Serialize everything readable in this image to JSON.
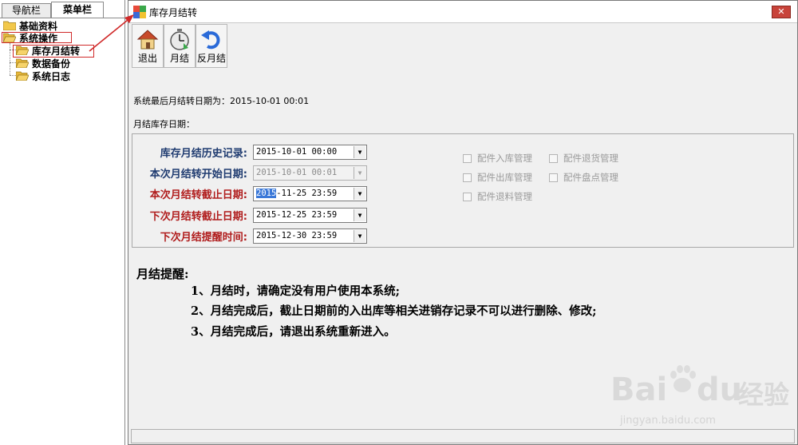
{
  "left_pane": {
    "tabs": [
      "导航栏",
      "菜单栏"
    ],
    "tree": [
      {
        "label": "基础资料",
        "level": 0
      },
      {
        "label": "系统操作",
        "level": 0
      },
      {
        "label": "库存月结转",
        "level": 1
      },
      {
        "label": "数据备份",
        "level": 1
      },
      {
        "label": "系统日志",
        "level": 1
      }
    ]
  },
  "window": {
    "title": "库存月结转",
    "close_label": "✕",
    "toolbar": [
      {
        "label": "退出",
        "icon": "home-icon"
      },
      {
        "label": "月结",
        "icon": "stopwatch-icon"
      },
      {
        "label": "反月结",
        "icon": "undo-icon"
      }
    ],
    "last_close_text": "系统最后月结转日期为：2015-10-01 00:01",
    "inventory_date_label": "月结库存日期：",
    "fields": [
      {
        "label": "库存月结历史记录:",
        "value": "2015-10-01 00:00",
        "color": "navy",
        "disabled": false
      },
      {
        "label": "本次月结转开始日期:",
        "value": "2015-10-01 00:01",
        "color": "navy",
        "disabled": true
      },
      {
        "label": "本次月结转截止日期:",
        "value_selected": "2015",
        "value_rest": "-11-25 23:59",
        "color": "red",
        "disabled": false
      },
      {
        "label": "下次月结转截止日期:",
        "value": "2015-12-25 23:59",
        "color": "red",
        "disabled": false
      },
      {
        "label": "下次月结提醒时间:",
        "value": "2015-12-30 23:59",
        "color": "red",
        "disabled": false
      }
    ],
    "checkboxes": [
      "配件入库管理",
      "配件退货管理",
      "配件出库管理",
      "配件盘点管理",
      "配件退料管理"
    ],
    "reminder": {
      "title": "月结提醒:",
      "items": [
        "1、月结时，请确定没有用户使用本系统;",
        "2、月结完成后，截止日期前的入出库等相关进销存记录不可以进行删除、修改;",
        "3、月结完成后，请退出系统重新进入。"
      ]
    }
  },
  "watermark": {
    "brand": "Bai",
    "brand2": "du",
    "brand_cn": "经验",
    "url": "jingyan.baidu.com"
  },
  "colors": {
    "navy": "#1f3b70",
    "red": "#b01c1c",
    "highlight": "#3a78d8",
    "annotation": "#d02a2a"
  }
}
